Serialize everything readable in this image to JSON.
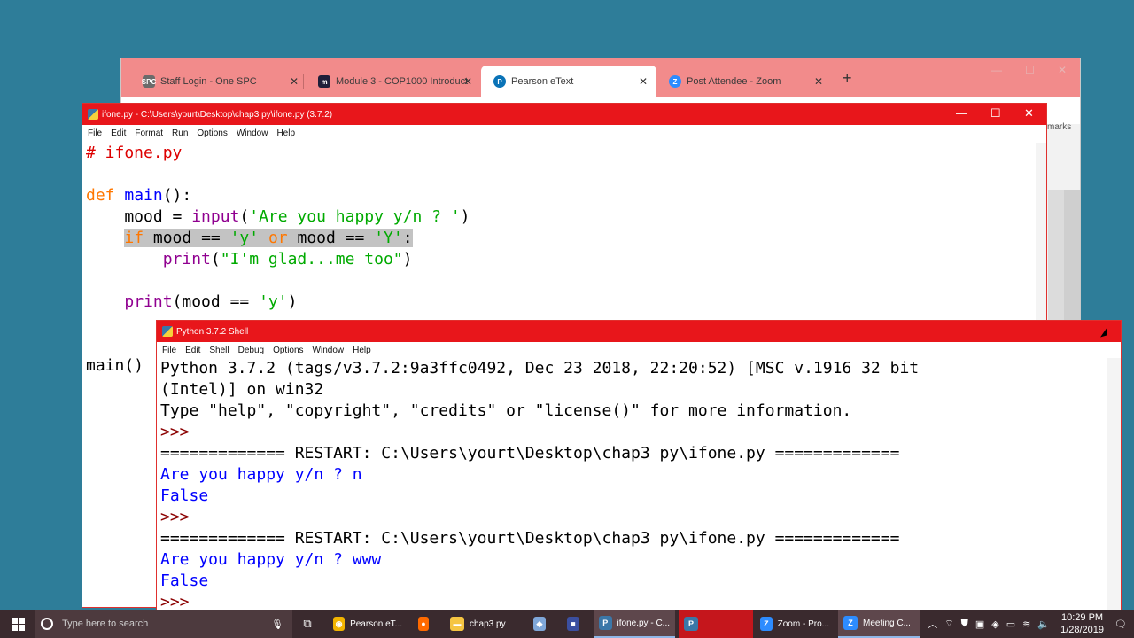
{
  "browser": {
    "tabs": [
      {
        "label": "Staff Login - One SPC",
        "fav": "SPC",
        "fav_color": "#6b6b6b"
      },
      {
        "label": "Module 3 - COP1000 Introductio",
        "fav": "m",
        "fav_color": "#1f1f3a"
      },
      {
        "label": "Pearson eText",
        "fav": "P",
        "fav_color": "#0a73b7"
      },
      {
        "label": "Post Attendee - Zoom",
        "fav": "Z",
        "fav_color": "#2d8cff"
      }
    ],
    "new_tab": "+",
    "bookmarks_stub": "marks"
  },
  "editor": {
    "title": "ifone.py - C:\\Users\\yourt\\Desktop\\chap3 py\\ifone.py (3.7.2)",
    "menu": [
      "File",
      "Edit",
      "Format",
      "Run",
      "Options",
      "Window",
      "Help"
    ],
    "code": {
      "comment": "# ifone.py",
      "def_kw": "def",
      "def_name": "main",
      "def_rest": "():",
      "l3_a": "    mood = ",
      "l3_bi": "input",
      "l3_b": "(",
      "l3_str": "'Are you happy y/n ? '",
      "l3_c": ")",
      "l4_indent": "    ",
      "l4_kw1": "if",
      "l4_a": " mood == ",
      "l4_str1": "'y'",
      "l4_sp": " ",
      "l4_kw2": "or",
      "l4_b": " mood == ",
      "l4_str2": "'Y'",
      "l4_c": ":",
      "l5_indent": "        ",
      "l5_bi": "print",
      "l5_a": "(",
      "l5_str": "\"I'm glad...me too\"",
      "l5_b": ")",
      "l7_indent": "    ",
      "l7_bi": "print",
      "l7_a": "(mood == ",
      "l7_str": "'y'",
      "l7_b": ")",
      "call": "main()"
    }
  },
  "shell": {
    "title": "Python 3.7.2 Shell",
    "menu": [
      "File",
      "Edit",
      "Shell",
      "Debug",
      "Options",
      "Window",
      "Help"
    ],
    "lines": [
      {
        "t": "Python 3.7.2 (tags/v3.7.2:9a3ffc0492, Dec 23 2018, 22:20:52) [MSC v.1916 32 bit",
        "c": "s-out"
      },
      {
        "t": "(Intel)] on win32",
        "c": "s-out"
      },
      {
        "t": "Type \"help\", \"copyright\", \"credits\" or \"license()\" for more information.",
        "c": "s-out"
      },
      {
        "t": ">>> ",
        "c": "s-prompt"
      },
      {
        "t": "============= RESTART: C:\\Users\\yourt\\Desktop\\chap3 py\\ifone.py =============",
        "c": "s-restart"
      },
      {
        "t": "Are you happy y/n ? n",
        "c": "s-stdout"
      },
      {
        "t": "False",
        "c": "s-stdout"
      },
      {
        "t": ">>> ",
        "c": "s-prompt"
      },
      {
        "t": "============= RESTART: C:\\Users\\yourt\\Desktop\\chap3 py\\ifone.py =============",
        "c": "s-restart"
      },
      {
        "t": "Are you happy y/n ? www",
        "c": "s-stdout"
      },
      {
        "t": "False",
        "c": "s-stdout"
      },
      {
        "t": ">>> ",
        "c": "s-prompt"
      }
    ]
  },
  "taskbar": {
    "search_placeholder": "Type here to search",
    "apps": [
      {
        "label": "Pearson eT...",
        "icon": "chrome-icon",
        "glyph": "◉",
        "color": "#f2b400"
      },
      {
        "label": "",
        "icon": "firefox-icon",
        "glyph": "●",
        "color": "#ff6a00"
      },
      {
        "label": "chap3 py",
        "icon": "folder-icon",
        "glyph": "▬",
        "color": "#f5c542"
      },
      {
        "label": "",
        "icon": "box-icon",
        "glyph": "◆",
        "color": "#7fa7d9"
      },
      {
        "label": "",
        "icon": "app-icon",
        "glyph": "■",
        "color": "#3b4fa0"
      },
      {
        "label": "ifone.py - C...",
        "icon": "python-icon",
        "glyph": "P",
        "color": "#3b77a8"
      },
      {
        "label": "",
        "icon": "python-shell-icon",
        "glyph": "P",
        "color": "#3b77a8"
      },
      {
        "label": "Zoom - Pro...",
        "icon": "zoom-icon",
        "glyph": "Z",
        "color": "#2d8cff"
      },
      {
        "label": "Meeting C...",
        "icon": "zoom-meeting-icon",
        "glyph": "Z",
        "color": "#2d8cff"
      }
    ],
    "time": "10:29 PM",
    "date": "1/28/2019"
  }
}
